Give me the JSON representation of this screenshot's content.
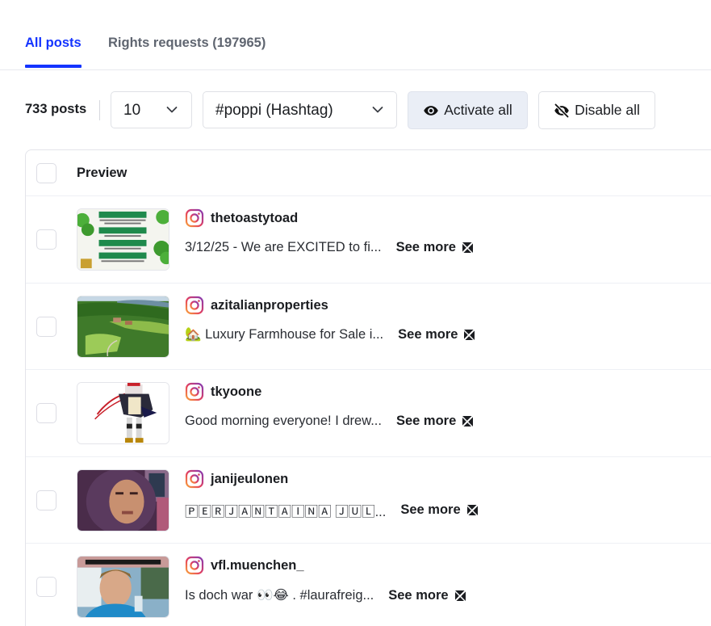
{
  "tabs": [
    {
      "label": "All posts",
      "active": true
    },
    {
      "label": "Rights requests (197965)",
      "active": false
    }
  ],
  "toolbar": {
    "post_count": "733 posts",
    "per_page_value": "10",
    "source_value": "#poppi (Hashtag)",
    "activate_all_label": "Activate all",
    "disable_all_label": "Disable all"
  },
  "table": {
    "header_preview": "Preview",
    "see_more_label": "See more",
    "rows": [
      {
        "platform": "instagram",
        "username": "thetoastytoad",
        "caption": "3/12/25 - We are EXCITED to fi...",
        "thumbnail": "green menu with shamrocks: Taste The Rainbow, Lucky Toda, Blarney Mocha, Lucky Charm"
      },
      {
        "platform": "instagram",
        "username": "azitalianproperties",
        "caption": "🏡 Luxury Farmhouse for Sale i...",
        "thumbnail": "aerial view of green hills with farmhouse"
      },
      {
        "platform": "instagram",
        "username": "tkyoone",
        "caption": "Good morning everyone! I drew...",
        "thumbnail": "illustrated armored character"
      },
      {
        "platform": "instagram",
        "username": "janijeulonen",
        "caption": "🄿🄴🅁🄹🄰🄽🅃🄰🄸🄽🄰 🄹🅄🄻...",
        "thumbnail": "man with long curly hair"
      },
      {
        "platform": "instagram",
        "username": "vfl.muenchen_",
        "caption": "Is doch war 👀😂 . #laurafreig...",
        "thumbnail": "woman holding wine glass"
      }
    ]
  },
  "colors": {
    "accent": "#1434ff",
    "activate_bg": "#eaeef6",
    "text": "#1b1d21",
    "muted_tab": "#5f6570"
  }
}
